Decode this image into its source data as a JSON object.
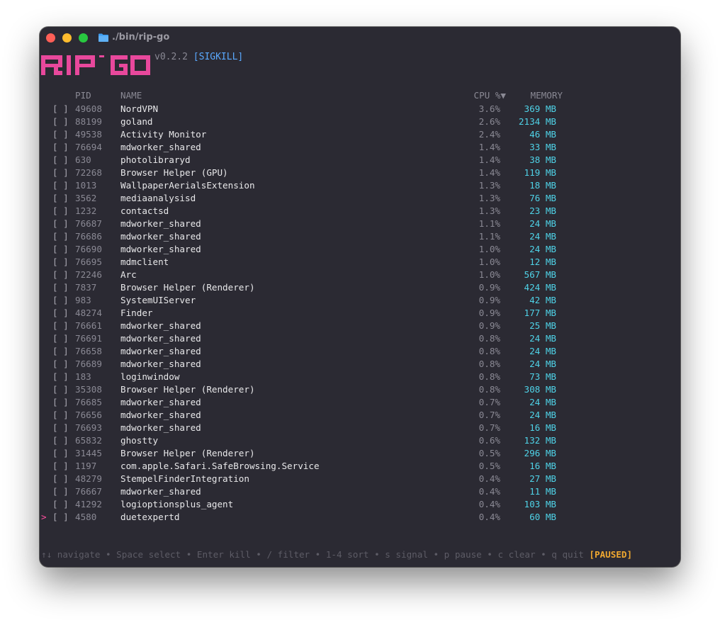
{
  "window": {
    "title": "./bin/rip-go",
    "folder_icon": "folder-icon"
  },
  "app": {
    "logo_text": "RIP-GO",
    "logo_color": "#e8489c",
    "version": "v0.2.2",
    "signal": "[SIGKILL]"
  },
  "table": {
    "headers": {
      "pid": "PID",
      "name": "NAME",
      "cpu": "CPU %▼",
      "memory": "MEMORY"
    },
    "selected_row_cursor": ">",
    "rows": [
      {
        "check": "[ ]",
        "pid": "49608",
        "name": "NordVPN",
        "cpu": "3.6%",
        "mem": "369 MB"
      },
      {
        "check": "[ ]",
        "pid": "88199",
        "name": "goland",
        "cpu": "2.6%",
        "mem": "2134 MB"
      },
      {
        "check": "[ ]",
        "pid": "49538",
        "name": "Activity Monitor",
        "cpu": "2.4%",
        "mem": "46 MB"
      },
      {
        "check": "[ ]",
        "pid": "76694",
        "name": "mdworker_shared",
        "cpu": "1.4%",
        "mem": "33 MB"
      },
      {
        "check": "[ ]",
        "pid": "630",
        "name": "photolibraryd",
        "cpu": "1.4%",
        "mem": "38 MB"
      },
      {
        "check": "[ ]",
        "pid": "72268",
        "name": "Browser Helper (GPU)",
        "cpu": "1.4%",
        "mem": "119 MB"
      },
      {
        "check": "[ ]",
        "pid": "1013",
        "name": "WallpaperAerialsExtension",
        "cpu": "1.3%",
        "mem": "18 MB"
      },
      {
        "check": "[ ]",
        "pid": "3562",
        "name": "mediaanalysisd",
        "cpu": "1.3%",
        "mem": "76 MB"
      },
      {
        "check": "[ ]",
        "pid": "1232",
        "name": "contactsd",
        "cpu": "1.3%",
        "mem": "23 MB"
      },
      {
        "check": "[ ]",
        "pid": "76687",
        "name": "mdworker_shared",
        "cpu": "1.1%",
        "mem": "24 MB"
      },
      {
        "check": "[ ]",
        "pid": "76686",
        "name": "mdworker_shared",
        "cpu": "1.1%",
        "mem": "24 MB"
      },
      {
        "check": "[ ]",
        "pid": "76690",
        "name": "mdworker_shared",
        "cpu": "1.0%",
        "mem": "24 MB"
      },
      {
        "check": "[ ]",
        "pid": "76695",
        "name": "mdmclient",
        "cpu": "1.0%",
        "mem": "12 MB"
      },
      {
        "check": "[ ]",
        "pid": "72246",
        "name": "Arc",
        "cpu": "1.0%",
        "mem": "567 MB"
      },
      {
        "check": "[ ]",
        "pid": "7837",
        "name": "Browser Helper (Renderer)",
        "cpu": "0.9%",
        "mem": "424 MB"
      },
      {
        "check": "[ ]",
        "pid": "983",
        "name": "SystemUIServer",
        "cpu": "0.9%",
        "mem": "42 MB"
      },
      {
        "check": "[ ]",
        "pid": "48274",
        "name": "Finder",
        "cpu": "0.9%",
        "mem": "177 MB"
      },
      {
        "check": "[ ]",
        "pid": "76661",
        "name": "mdworker_shared",
        "cpu": "0.9%",
        "mem": "25 MB"
      },
      {
        "check": "[ ]",
        "pid": "76691",
        "name": "mdworker_shared",
        "cpu": "0.8%",
        "mem": "24 MB"
      },
      {
        "check": "[ ]",
        "pid": "76658",
        "name": "mdworker_shared",
        "cpu": "0.8%",
        "mem": "24 MB"
      },
      {
        "check": "[ ]",
        "pid": "76689",
        "name": "mdworker_shared",
        "cpu": "0.8%",
        "mem": "24 MB"
      },
      {
        "check": "[ ]",
        "pid": "183",
        "name": "loginwindow",
        "cpu": "0.8%",
        "mem": "73 MB"
      },
      {
        "check": "[ ]",
        "pid": "35308",
        "name": "Browser Helper (Renderer)",
        "cpu": "0.8%",
        "mem": "308 MB"
      },
      {
        "check": "[ ]",
        "pid": "76685",
        "name": "mdworker_shared",
        "cpu": "0.7%",
        "mem": "24 MB"
      },
      {
        "check": "[ ]",
        "pid": "76656",
        "name": "mdworker_shared",
        "cpu": "0.7%",
        "mem": "24 MB"
      },
      {
        "check": "[ ]",
        "pid": "76693",
        "name": "mdworker_shared",
        "cpu": "0.7%",
        "mem": "16 MB"
      },
      {
        "check": "[ ]",
        "pid": "65832",
        "name": "ghostty",
        "cpu": "0.6%",
        "mem": "132 MB"
      },
      {
        "check": "[ ]",
        "pid": "31445",
        "name": "Browser Helper (Renderer)",
        "cpu": "0.5%",
        "mem": "296 MB"
      },
      {
        "check": "[ ]",
        "pid": "1197",
        "name": "com.apple.Safari.SafeBrowsing.Service",
        "cpu": "0.5%",
        "mem": "16 MB"
      },
      {
        "check": "[ ]",
        "pid": "48279",
        "name": "StempelFinderIntegration",
        "cpu": "0.4%",
        "mem": "27 MB"
      },
      {
        "check": "[ ]",
        "pid": "76667",
        "name": "mdworker_shared",
        "cpu": "0.4%",
        "mem": "11 MB"
      },
      {
        "check": "[ ]",
        "pid": "41292",
        "name": "logioptionsplus_agent",
        "cpu": "0.4%",
        "mem": "103 MB"
      },
      {
        "check": "[ ]",
        "pid": "4580",
        "name": "duetexpertd",
        "cpu": "0.4%",
        "mem": "60 MB",
        "selected": true
      }
    ]
  },
  "footer": {
    "help": "↑↓ navigate • Space select • Enter kill • / filter • 1-4 sort • s signal • p pause • c clear • q quit",
    "status": "[PAUSED]"
  },
  "colors": {
    "background": "#2b2a33",
    "accent_pink": "#e8489c",
    "memory_cyan": "#4fd3e8",
    "signal_blue": "#5aa9ff",
    "paused_orange": "#f0a830"
  }
}
